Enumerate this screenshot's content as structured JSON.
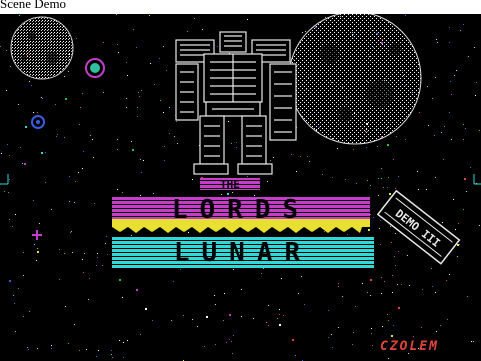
{
  "window": {
    "title": "Scene Demo"
  },
  "scene": {
    "logo_top_word": "THE",
    "logo_main_word": "LORDS",
    "logo_sub_word": "LUNAR",
    "badge_text": "DEMO III",
    "credit": "CZOLEM"
  },
  "colors": {
    "background": "#000000",
    "logo_magenta": "#c43cc8",
    "logo_yellow": "#e8e030",
    "logo_cyan": "#30d8d8",
    "credit_red": "#e0453a",
    "planet_white": "#e8e8e8",
    "star_palette": [
      "#ffffff",
      "#e8e030",
      "#30d8d8",
      "#c43cc8",
      "#e0453a",
      "#30c040",
      "#3a5ce0"
    ]
  },
  "icons": [
    "planet-icon",
    "moon-icon",
    "robot-mech-icon",
    "sparkle-icon",
    "demo-badge-icon"
  ]
}
